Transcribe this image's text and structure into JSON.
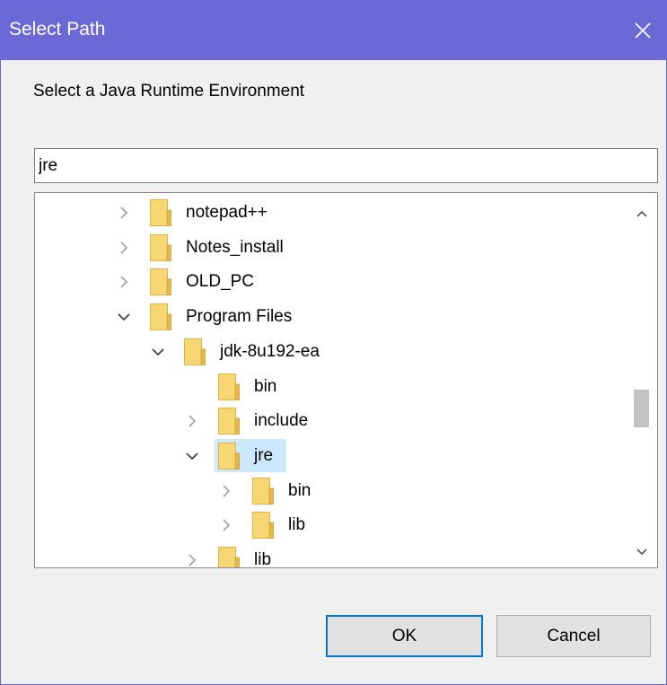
{
  "window": {
    "title": "Select Path",
    "close_icon": "close-icon"
  },
  "prompt": "Select a Java Runtime Environment",
  "search": {
    "value": "jre"
  },
  "tree": {
    "items": [
      {
        "label": "notepad++",
        "expander": "collapsed",
        "selected": false
      },
      {
        "label": "Notes_install",
        "expander": "collapsed",
        "selected": false
      },
      {
        "label": "OLD_PC",
        "expander": "collapsed",
        "selected": false
      },
      {
        "label": "Program Files",
        "expander": "expanded",
        "selected": false
      },
      {
        "label": "jdk-8u192-ea",
        "expander": "expanded",
        "selected": false
      },
      {
        "label": "bin",
        "expander": "none",
        "selected": false
      },
      {
        "label": "include",
        "expander": "collapsed",
        "selected": false
      },
      {
        "label": "jre",
        "expander": "expanded",
        "selected": true
      },
      {
        "label": "bin",
        "expander": "collapsed",
        "selected": false
      },
      {
        "label": "lib",
        "expander": "collapsed",
        "selected": false
      },
      {
        "label": "lib",
        "expander": "collapsed",
        "selected": false
      }
    ]
  },
  "buttons": {
    "ok": "OK",
    "cancel": "Cancel"
  },
  "colors": {
    "titlebar": "#6b69d6",
    "selection": "#cce8ff",
    "folder": "#f7d774",
    "ok_border": "#0078d7"
  }
}
